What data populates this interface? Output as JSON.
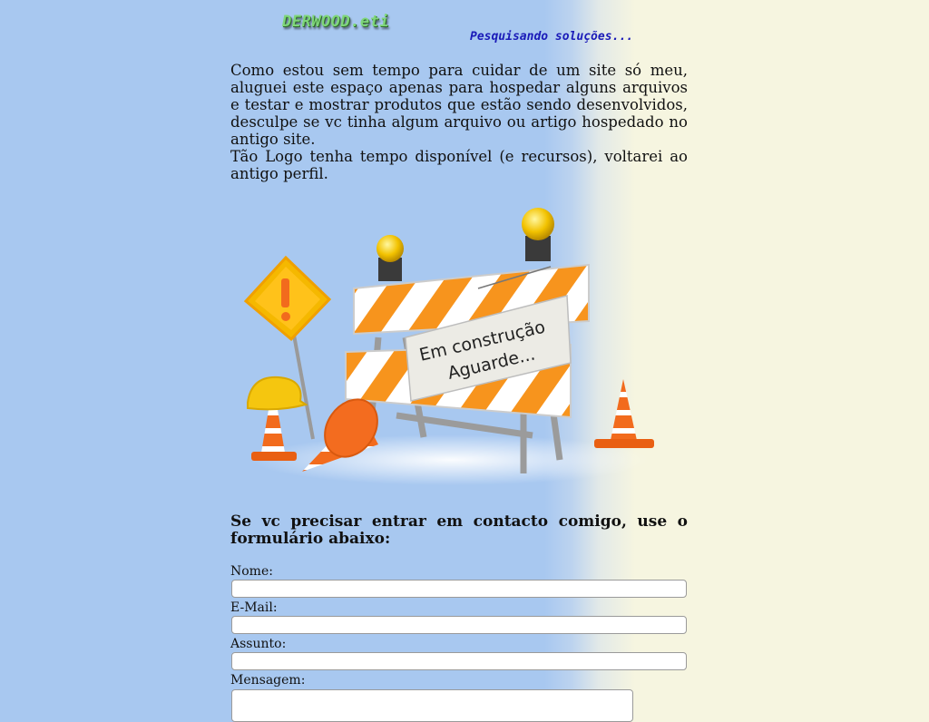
{
  "header": {
    "logo": "DERWOOD.eti",
    "tagline": "Pesquisando soluções..."
  },
  "intro": {
    "paragraph1": "Como estou sem tempo para cuidar de um site só meu, aluguei este espaço apenas para hospedar alguns arquivos e testar e mostrar produtos que estão sendo desenvolvidos, desculpe se vc tinha algum arquivo ou artigo hospedado no antigo site.",
    "paragraph2": "Tão Logo tenha tempo disponível (e recursos), voltarei ao antigo perfil."
  },
  "hero": {
    "sign_line1": "Em construção",
    "sign_line2": "Aguarde..."
  },
  "contact": {
    "title": "Se vc precisar entrar em contacto comigo, use o formulário abaixo:",
    "name_label": "Nome:",
    "name_value": "",
    "email_label": "E-Mail:",
    "email_value": "",
    "subject_label": "Assunto:",
    "subject_value": "",
    "message_label": "Mensagem:",
    "message_value": ""
  },
  "colors": {
    "background_left": "#a8c8f0",
    "background_right": "#f6f5e0",
    "logo": "#7fd67a",
    "tagline": "#1a1ab8",
    "stripe_orange": "#f7941d"
  }
}
